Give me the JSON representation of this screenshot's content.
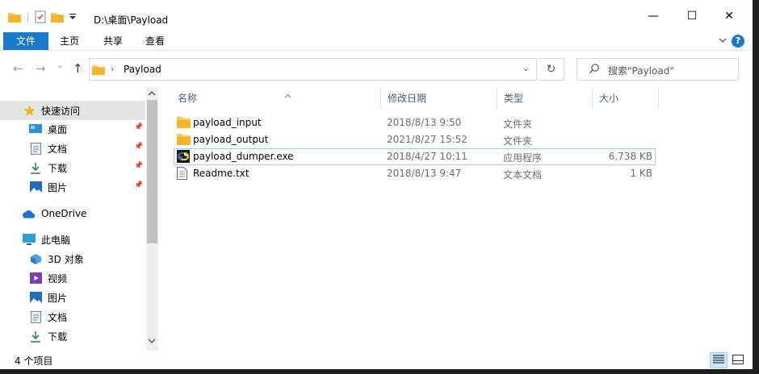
{
  "titlebar": {
    "title": "D:\\桌面\\Payload",
    "minimize": "—",
    "maximize": "☐",
    "close": "✕"
  },
  "ribbon": {
    "tabs": [
      "文件",
      "主页",
      "共享",
      "查看"
    ],
    "expand_icon": "chevron-down-icon",
    "help": "?"
  },
  "navbar": {
    "back": "←",
    "forward": "→",
    "recent": "⌄",
    "up": "↑",
    "crumb_sep": "›",
    "crumb": "Payload",
    "dropdown": "⌄",
    "refresh": "↻",
    "search_placeholder": "搜索\"Payload\""
  },
  "sidebar": {
    "items": [
      {
        "label": "快速访问",
        "icon": "star-icon"
      },
      {
        "label": "桌面",
        "icon": "desktop-icon",
        "pinned": true
      },
      {
        "label": "文档",
        "icon": "document-icon",
        "pinned": true
      },
      {
        "label": "下载",
        "icon": "download-icon",
        "pinned": true
      },
      {
        "label": "图片",
        "icon": "picture-icon",
        "pinned": true
      },
      {
        "label": "OneDrive",
        "icon": "cloud-icon"
      },
      {
        "label": "此电脑",
        "icon": "computer-icon"
      },
      {
        "label": "3D 对象",
        "icon": "cube-icon"
      },
      {
        "label": "视频",
        "icon": "video-icon"
      },
      {
        "label": "图片",
        "icon": "picture-icon"
      },
      {
        "label": "文档",
        "icon": "document-icon"
      },
      {
        "label": "下载",
        "icon": "download-icon"
      }
    ]
  },
  "columns": {
    "name": "名称",
    "date": "修改日期",
    "type": "类型",
    "size": "大小"
  },
  "files": [
    {
      "name": "payload_input",
      "date": "2018/8/13 9:50",
      "type": "文件夹",
      "size": "",
      "icon": "folder-icon"
    },
    {
      "name": "payload_output",
      "date": "2021/8/27 15:52",
      "type": "文件夹",
      "size": "",
      "icon": "folder-icon"
    },
    {
      "name": "payload_dumper.exe",
      "date": "2018/4/27 10:11",
      "type": "应用程序",
      "size": "6,738 KB",
      "icon": "python-exe-icon"
    },
    {
      "name": "Readme.txt",
      "date": "2018/8/13 9:47",
      "type": "文本文档",
      "size": "1 KB",
      "icon": "text-file-icon"
    }
  ],
  "status": {
    "count": "4 个项目"
  },
  "colors": {
    "accent": "#1979ca",
    "folder": "#ffc83d",
    "selection_border": "#99d1ff"
  }
}
